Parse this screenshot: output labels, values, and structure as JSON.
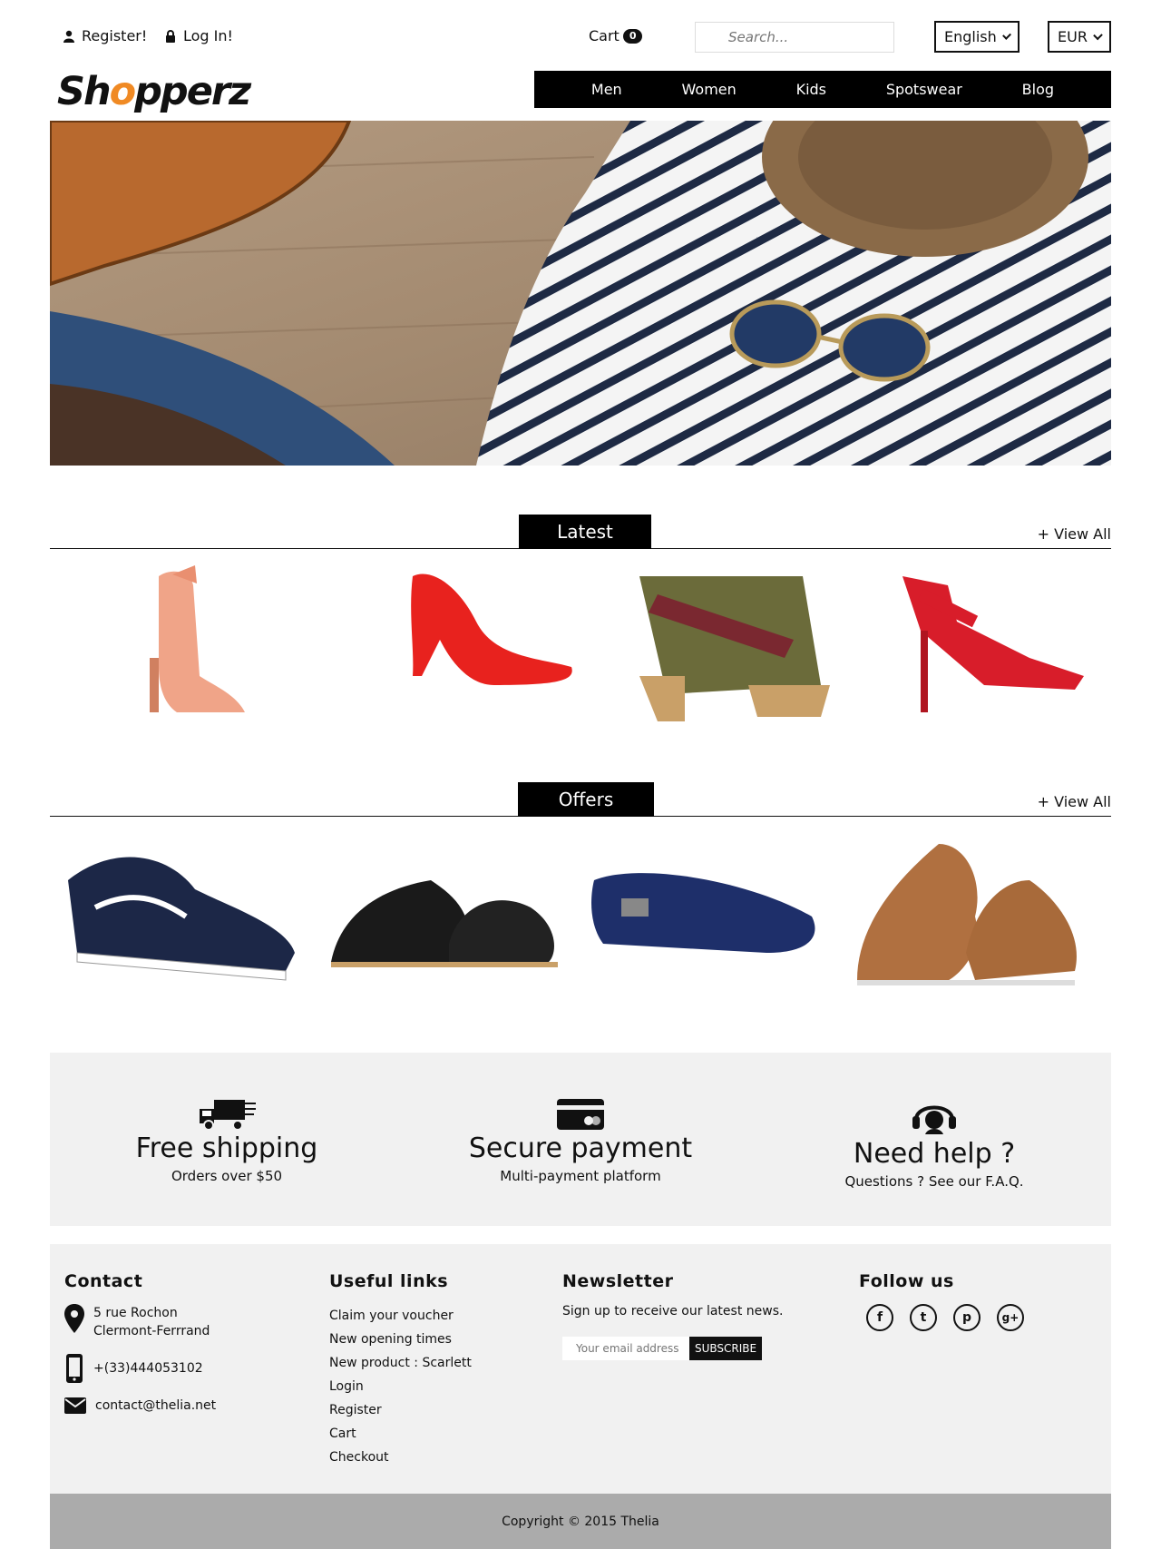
{
  "topbar": {
    "register_label": "Register!",
    "login_label": "Log In!",
    "cart_label": "Cart",
    "cart_count": "0",
    "search_placeholder": "Search...",
    "language": "English",
    "currency": "EUR"
  },
  "logo": {
    "part1": "Sh",
    "part2": "o",
    "part3": "pperz"
  },
  "nav": {
    "items": [
      {
        "label": "Men"
      },
      {
        "label": "Women"
      },
      {
        "label": "Kids"
      },
      {
        "label": "Spotswear"
      },
      {
        "label": "Blog"
      }
    ]
  },
  "latest": {
    "title": "Latest",
    "view_all": "+ View All",
    "products": [
      "peach-ankle-strap-heel",
      "red-pump",
      "cross-strap-cork-sandal",
      "red-strappy-heel"
    ]
  },
  "offers": {
    "title": "Offers",
    "view_all": "+ View All",
    "products": [
      "navy-sneaker",
      "black-derby-shoes",
      "navy-loafer",
      "brown-casual-shoes"
    ]
  },
  "features": [
    {
      "icon": "truck-icon",
      "title": "Free shipping",
      "subtitle": "Orders over $50"
    },
    {
      "icon": "credit-card-icon",
      "title": "Secure payment",
      "subtitle": "Multi-payment platform"
    },
    {
      "icon": "headset-icon",
      "title": "Need help ?",
      "subtitle": "Questions ? See our F.A.Q."
    }
  ],
  "footer": {
    "contact": {
      "title": "Contact",
      "address_line1": "5 rue Rochon",
      "address_line2": "Clermont-Ferrrand",
      "phone": "+(33)444053102",
      "email": "contact@thelia.net"
    },
    "links": {
      "title": "Useful links",
      "items": [
        "Claim your voucher",
        "New opening times",
        "New product : Scarlett",
        "Login",
        "Register",
        "Cart",
        "Checkout"
      ]
    },
    "newsletter": {
      "title": "Newsletter",
      "text": "Sign up to receive our latest news.",
      "placeholder": "Your email address",
      "button": "SUBSCRIBE"
    },
    "follow": {
      "title": "Follow us",
      "networks": [
        {
          "icon": "facebook-icon",
          "glyph": "f"
        },
        {
          "icon": "tumblr-icon",
          "glyph": "t"
        },
        {
          "icon": "pinterest-icon",
          "glyph": "p"
        },
        {
          "icon": "google-plus-icon",
          "glyph": "g+"
        }
      ]
    }
  },
  "copyright": "Copyright © 2015 Thelia",
  "colors": {
    "accent": "#f08a24",
    "dark": "#000000",
    "panel": "#f1f1f1",
    "footer_bar": "#ababab"
  }
}
